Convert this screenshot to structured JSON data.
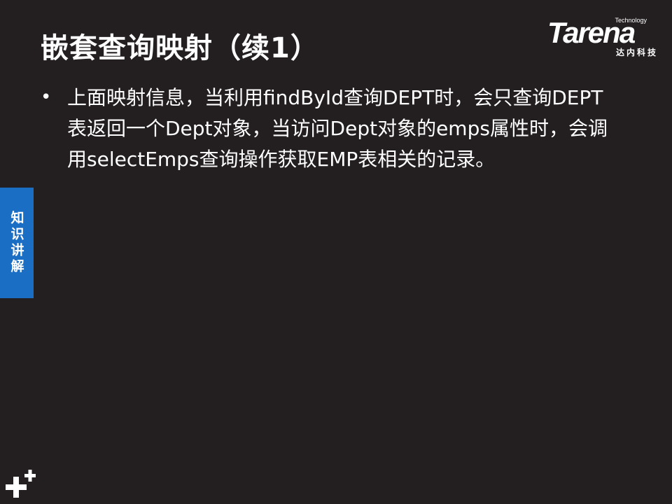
{
  "slide": {
    "title": "嵌套查询映射（续1）",
    "bullets": [
      "上面映射信息，当利用findById查询DEPT时，会只查询DEPT表返回一个Dept对象，当访问Dept对象的emps属性时，会调用selectEmps查询操作获取EMP表相关的记录。"
    ],
    "bullet_symbol": "•"
  },
  "logo": {
    "small_text": "Technology",
    "brand": "Tarena",
    "chinese": "达内科技"
  },
  "side_tab": {
    "label": "知识讲解",
    "color": "#1a6fc4"
  },
  "corner": {
    "icon": "plus-plus-icon"
  },
  "colors": {
    "background": "#231f20",
    "text": "#ffffff"
  }
}
